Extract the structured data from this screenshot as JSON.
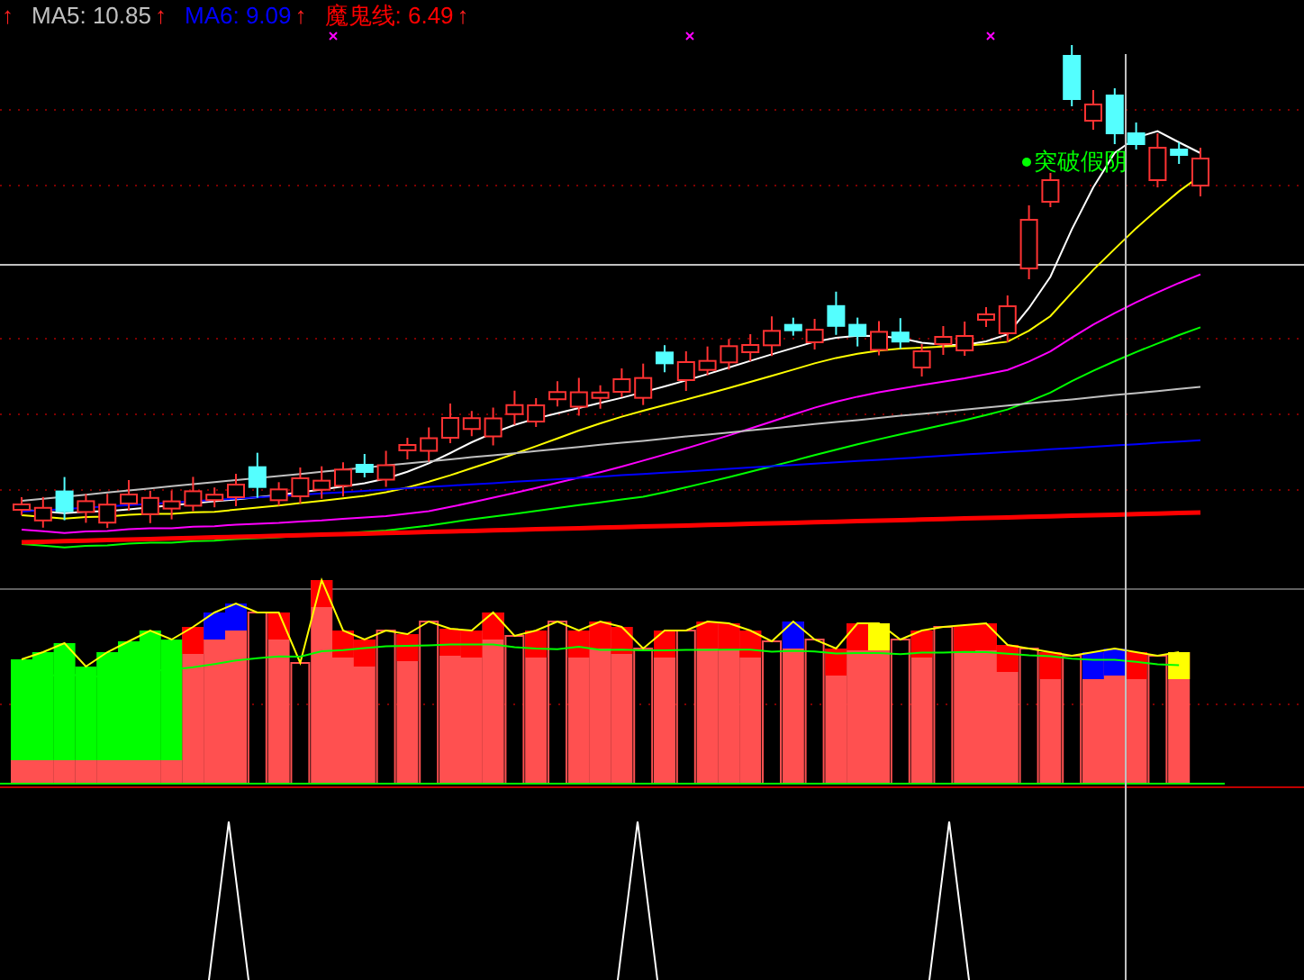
{
  "legend": {
    "lead_arrow": "↑",
    "indicators": [
      {
        "text": "MA5: 10.85",
        "arrow": "↑",
        "color": "#c0c0c0"
      },
      {
        "text": "MA6: 9.09",
        "arrow": "↑",
        "color": "#0000ff"
      },
      {
        "text": "魔鬼线: 6.49",
        "arrow": "↑",
        "color": "#ff0000"
      }
    ]
  },
  "annotation": {
    "text": "突破假阴"
  }
}
